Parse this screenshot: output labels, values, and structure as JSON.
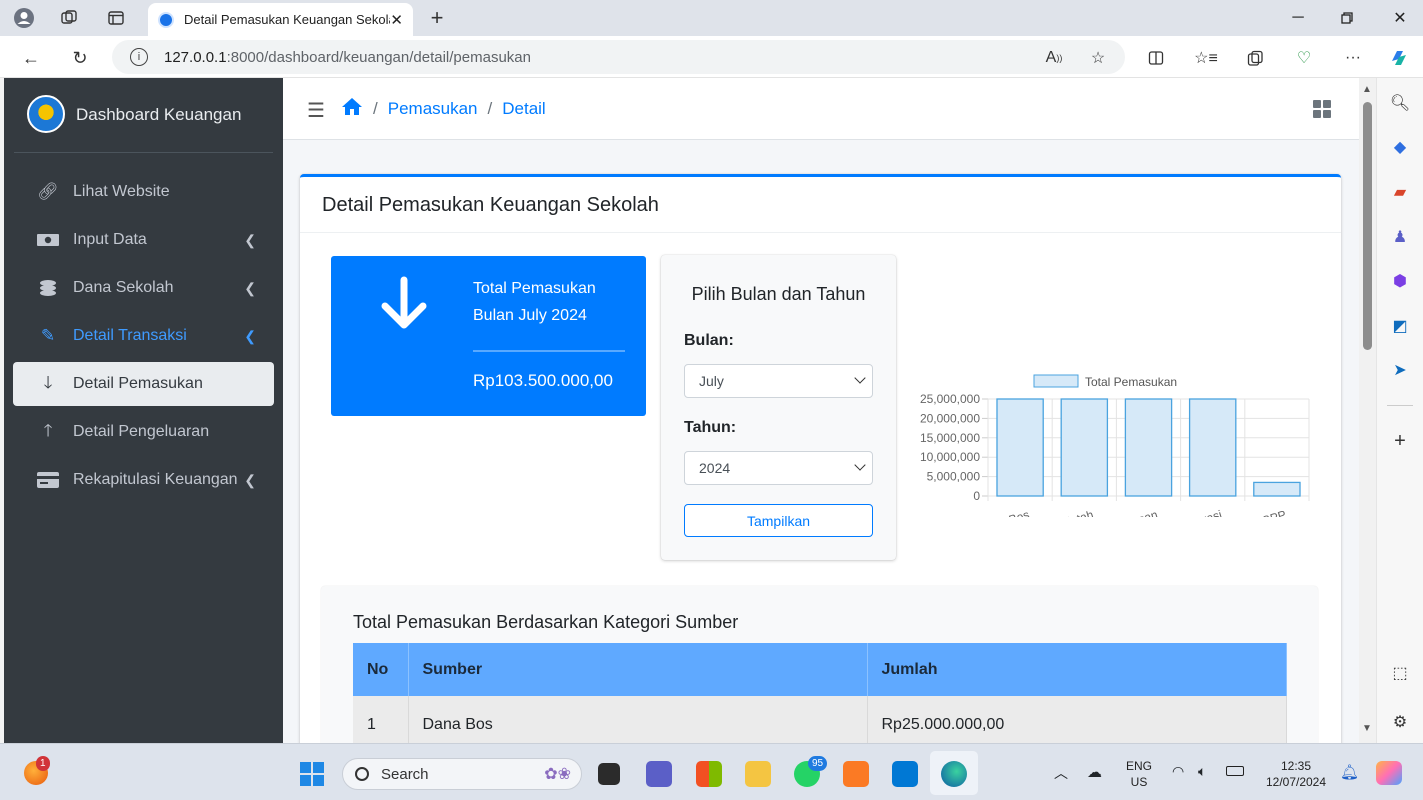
{
  "browser": {
    "tab_title": "Detail Pemasukan Keuangan Sekolah",
    "url_host": "127.0.0.1",
    "url_path": ":8000/dashboard/keuangan/detail/pemasukan"
  },
  "sidebar": {
    "brand": "Dashboard Keuangan",
    "items": [
      {
        "label": "Lihat Website",
        "icon": "link-icon"
      },
      {
        "label": "Input Data",
        "icon": "money-bill-icon"
      },
      {
        "label": "Dana Sekolah",
        "icon": "coins-icon"
      },
      {
        "label": "Detail Transaksi",
        "icon": "pen-icon"
      },
      {
        "label": "Detail Pemasukan",
        "icon": "arrow-down-icon"
      },
      {
        "label": "Detail Pengeluaran",
        "icon": "arrow-up-icon"
      },
      {
        "label": "Rekapitulasi Keuangan",
        "icon": "credit-card-icon"
      }
    ]
  },
  "breadcrumb": {
    "home_icon": "home-icon",
    "items": [
      "Pemasukan",
      "Detail"
    ]
  },
  "card": {
    "title": "Detail Pemasukan Keuangan Sekolah"
  },
  "info_box": {
    "title_line1": "Total Pemasukan",
    "title_line2": "Bulan July 2024",
    "amount": "Rp103.500.000,00",
    "icon": "arrow-down-icon",
    "color": "#007bff"
  },
  "filter": {
    "title": "Pilih Bulan dan Tahun",
    "month_label": "Bulan:",
    "month_value": "July",
    "year_label": "Tahun:",
    "year_value": "2024",
    "button": "Tampilkan"
  },
  "chart_data": {
    "type": "bar",
    "categories": [
      "Dana Bos",
      "Dana Pemerintah",
      "Ketua Yayasan",
      "Koperasi",
      "SPP"
    ],
    "series": [
      {
        "name": "Total Pemasukan",
        "values": [
          25000000,
          25000000,
          25000000,
          25000000,
          3500000
        ]
      }
    ],
    "y_ticks": [
      "0",
      "5,000,000",
      "10,000,000",
      "15,000,000",
      "20,000,000",
      "25,000,000"
    ],
    "ylim": [
      0,
      25000000
    ],
    "legend": "top",
    "grid": true,
    "bar_fill": "#d6e9f8",
    "bar_stroke": "#4aa3df"
  },
  "table": {
    "title": "Total Pemasukan Berdasarkan Kategori Sumber",
    "headers": [
      "No",
      "Sumber",
      "Jumlah"
    ],
    "rows": [
      {
        "no": "1",
        "sumber": "Dana Bos",
        "jumlah": "Rp25.000.000,00"
      }
    ]
  },
  "taskbar": {
    "search_placeholder": "Search",
    "lang_line1": "ENG",
    "lang_line2": "US",
    "time": "12:35",
    "date": "12/07/2024",
    "notif_badge": "1",
    "whatsapp_badge": "95"
  }
}
